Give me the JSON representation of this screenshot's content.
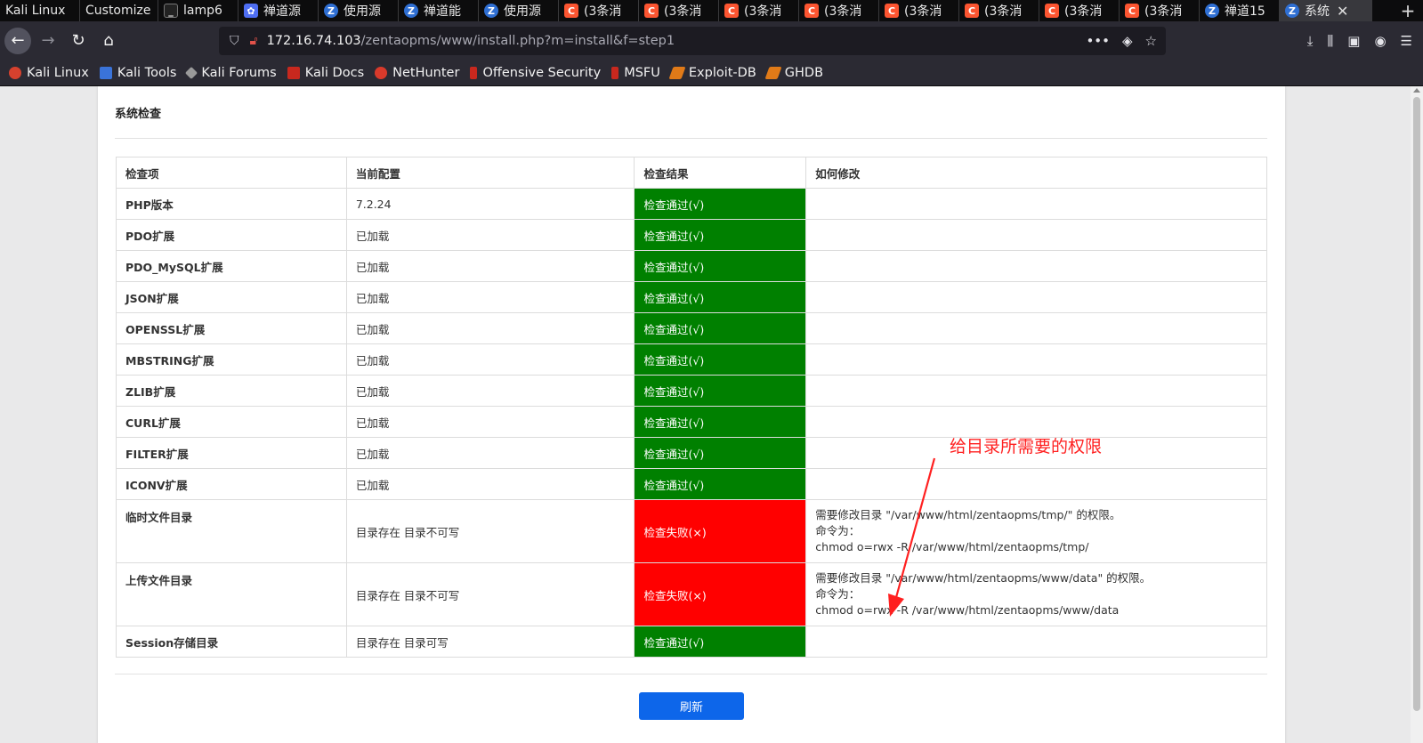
{
  "tabs": [
    {
      "title": "Kali Linux",
      "icon": "none",
      "active": false
    },
    {
      "title": "Customize",
      "icon": "none",
      "active": false
    },
    {
      "title": "lamp6",
      "icon": "terminal-icon",
      "active": false
    },
    {
      "title": "禅道源",
      "icon": "paw-icon",
      "active": false
    },
    {
      "title": "使用源",
      "icon": "zentao-icon",
      "active": false
    },
    {
      "title": "禅道能",
      "icon": "zentao-icon",
      "active": false
    },
    {
      "title": "使用源",
      "icon": "zentao-icon",
      "active": false
    },
    {
      "title": "(3条消",
      "icon": "csdn-icon",
      "active": false
    },
    {
      "title": "(3条消",
      "icon": "csdn-icon",
      "active": false
    },
    {
      "title": "(3条消",
      "icon": "csdn-icon",
      "active": false
    },
    {
      "title": "(3条消",
      "icon": "csdn-icon",
      "active": false
    },
    {
      "title": "(3条消",
      "icon": "csdn-icon",
      "active": false
    },
    {
      "title": "(3条消",
      "icon": "csdn-icon",
      "active": false
    },
    {
      "title": "(3条消",
      "icon": "csdn-icon",
      "active": false
    },
    {
      "title": "(3条消",
      "icon": "csdn-icon",
      "active": false
    },
    {
      "title": "禅道15",
      "icon": "zentao-icon",
      "active": false
    },
    {
      "title": "系统",
      "icon": "zentao-icon",
      "active": true
    }
  ],
  "url": {
    "host": "172.16.74.103",
    "path": "/zentaopms/www/install.php?m=install&f=step1"
  },
  "bookmarks": [
    {
      "label": "Kali Linux",
      "icon": "kali"
    },
    {
      "label": "Kali Tools",
      "icon": "tools"
    },
    {
      "label": "Kali Forums",
      "icon": "forums"
    },
    {
      "label": "Kali Docs",
      "icon": "docs"
    },
    {
      "label": "NetHunter",
      "icon": "nh"
    },
    {
      "label": "Offensive Security",
      "icon": "offsec"
    },
    {
      "label": "MSFU",
      "icon": "msfu"
    },
    {
      "label": "Exploit-DB",
      "icon": "edb"
    },
    {
      "label": "GHDB",
      "icon": "ghdb"
    }
  ],
  "page": {
    "title": "系统检查",
    "refresh_label": "刷新",
    "annotation": "给目录所需要的权限"
  },
  "table": {
    "headers": [
      "检查项",
      "当前配置",
      "检查结果",
      "如何修改"
    ],
    "rows": [
      {
        "item": "PHP版本",
        "config": "7.2.24",
        "result": "检查通过(√)",
        "status": "ok",
        "fix": []
      },
      {
        "item": "PDO扩展",
        "config": "已加载",
        "result": "检查通过(√)",
        "status": "ok",
        "fix": []
      },
      {
        "item": "PDO_MySQL扩展",
        "config": "已加载",
        "result": "检查通过(√)",
        "status": "ok",
        "fix": []
      },
      {
        "item": "JSON扩展",
        "config": "已加载",
        "result": "检查通过(√)",
        "status": "ok",
        "fix": []
      },
      {
        "item": "OPENSSL扩展",
        "config": "已加载",
        "result": "检查通过(√)",
        "status": "ok",
        "fix": []
      },
      {
        "item": "MBSTRING扩展",
        "config": "已加载",
        "result": "检查通过(√)",
        "status": "ok",
        "fix": []
      },
      {
        "item": "ZLIB扩展",
        "config": "已加载",
        "result": "检查通过(√)",
        "status": "ok",
        "fix": []
      },
      {
        "item": "CURL扩展",
        "config": "已加载",
        "result": "检查通过(√)",
        "status": "ok",
        "fix": []
      },
      {
        "item": "FILTER扩展",
        "config": "已加载",
        "result": "检查通过(√)",
        "status": "ok",
        "fix": []
      },
      {
        "item": "ICONV扩展",
        "config": "已加载",
        "result": "检查通过(√)",
        "status": "ok",
        "fix": []
      },
      {
        "item": "临时文件目录",
        "config": "目录存在 目录不可写",
        "result": "检查失败(×)",
        "status": "fail",
        "fix": [
          "需要修改目录 \"/var/www/html/zentaopms/tmp/\" 的权限。",
          "命令为：",
          "chmod o=rwx -R /var/www/html/zentaopms/tmp/"
        ]
      },
      {
        "item": "上传文件目录",
        "config": "目录存在 目录不可写",
        "result": "检查失败(×)",
        "status": "fail",
        "fix": [
          "需要修改目录 \"/var/www/html/zentaopms/www/data\" 的权限。",
          "命令为：",
          "chmod o=rwx -R /var/www/html/zentaopms/www/data"
        ]
      },
      {
        "item": "Session存储目录",
        "config": "目录存在 目录可写",
        "result": "检查通过(√)",
        "status": "ok",
        "fix": []
      }
    ]
  },
  "colors": {
    "pass": "#008000",
    "fail": "#ff0000",
    "primary": "#0d66ea",
    "annotation": "#ff2020"
  }
}
